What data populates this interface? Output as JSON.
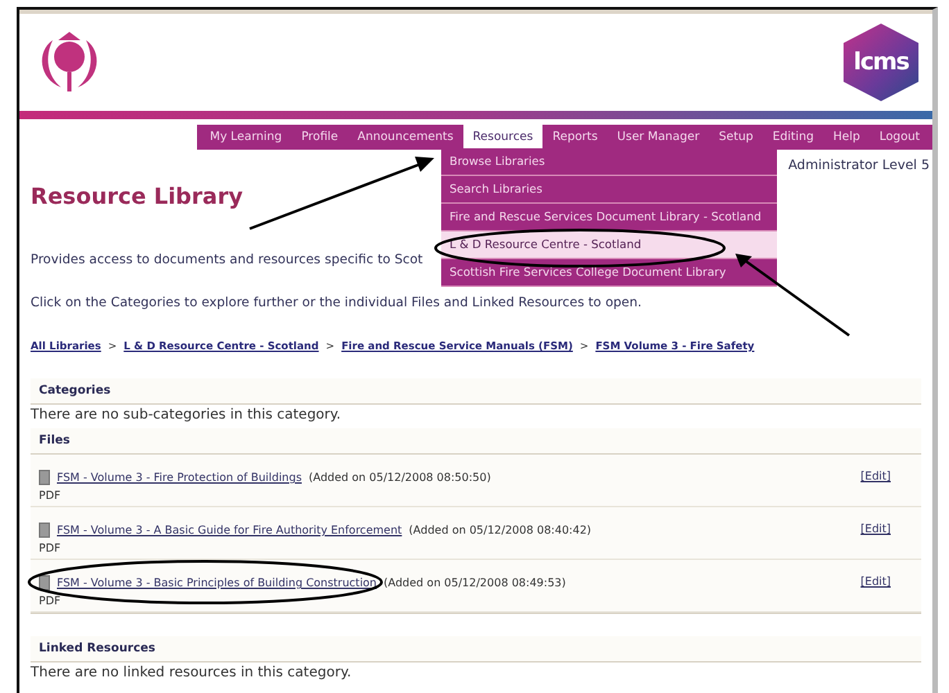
{
  "logo_text": "lcms",
  "nav": [
    {
      "label": "My Learning",
      "selected": false
    },
    {
      "label": "Profile",
      "selected": false
    },
    {
      "label": "Announcements",
      "selected": false
    },
    {
      "label": "Resources",
      "selected": true
    },
    {
      "label": "Reports",
      "selected": false
    },
    {
      "label": "User Manager",
      "selected": false
    },
    {
      "label": "Setup",
      "selected": false
    },
    {
      "label": "Editing",
      "selected": false
    },
    {
      "label": "Help",
      "selected": false
    },
    {
      "label": "Logout",
      "selected": false
    }
  ],
  "dropdown": [
    {
      "label": "Browse Libraries",
      "selected": false
    },
    {
      "label": "Search Libraries",
      "selected": false
    },
    {
      "label": "Fire and Rescue Services Document Library - Scotland",
      "selected": false
    },
    {
      "label": "L & D Resource Centre - Scotland",
      "selected": true
    },
    {
      "label": "Scottish Fire Services College Document Library",
      "selected": false
    }
  ],
  "user_level": "Administrator Level 5",
  "title": "Resource Library",
  "intro": [
    "Provides access to documents and resources specific to Scot",
    "Click on the Categories to explore further or the individual Files and Linked Resources to open."
  ],
  "breadcrumb_separator": ">",
  "breadcrumb": [
    "All Libraries",
    "L & D Resource Centre - Scotland",
    "Fire and Rescue Service Manuals (FSM)",
    "FSM Volume 3 - Fire Safety"
  ],
  "categories": {
    "heading": "Categories",
    "message": "There are no sub-categories in this category."
  },
  "files": {
    "heading": "Files",
    "rows": [
      {
        "title": "FSM - Volume 3 - Fire Protection of Buildings",
        "added": "(Added on 05/12/2008 08:50:50)",
        "type": "PDF",
        "action": "[Edit]"
      },
      {
        "title": "FSM - Volume 3 - A Basic Guide for Fire Authority Enforcement",
        "added": "(Added on 05/12/2008 08:40:42)",
        "type": "PDF",
        "action": "[Edit]"
      },
      {
        "title": "FSM - Volume 3 - Basic Principles of Building Construction",
        "added": "(Added on 05/12/2008 08:49:53)",
        "type": "PDF",
        "action": "[Edit]"
      }
    ]
  },
  "linked": {
    "heading": "Linked Resources",
    "message": "There are no linked resources in this category."
  }
}
